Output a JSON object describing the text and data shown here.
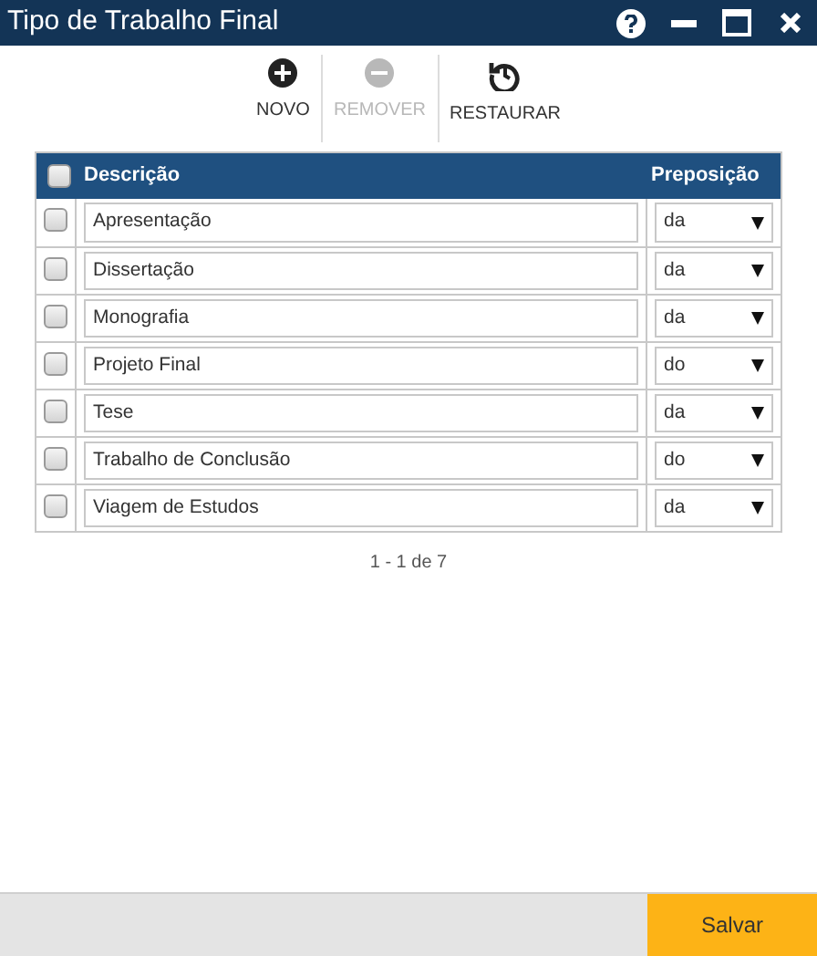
{
  "window": {
    "title": "Tipo de Trabalho Final"
  },
  "toolbar": [
    {
      "kind": "add",
      "label": "NOVO",
      "disabled": false
    },
    {
      "kind": "remove",
      "label": "REMOVER",
      "disabled": true
    },
    {
      "kind": "restore",
      "label": "RESTAURAR",
      "disabled": false
    }
  ],
  "table": {
    "select_all": {
      "checked": false
    },
    "columns": [
      "Descrição",
      "Preposição"
    ],
    "rows": [
      {
        "checked": false,
        "description": "Apresentação",
        "preposition": "da"
      },
      {
        "checked": false,
        "description": "Dissertação",
        "preposition": "da"
      },
      {
        "checked": false,
        "description": "Monografia",
        "preposition": "da"
      },
      {
        "checked": false,
        "description": "Projeto Final",
        "preposition": "do"
      },
      {
        "checked": false,
        "description": "Tese",
        "preposition": "da"
      },
      {
        "checked": false,
        "description": "Trabalho de Conclusão",
        "preposition": "do"
      },
      {
        "checked": false,
        "description": "Viagem de Estudos",
        "preposition": "da"
      }
    ]
  },
  "pagination": "1 - 1 de 7",
  "footer": {
    "save": "Salvar"
  }
}
